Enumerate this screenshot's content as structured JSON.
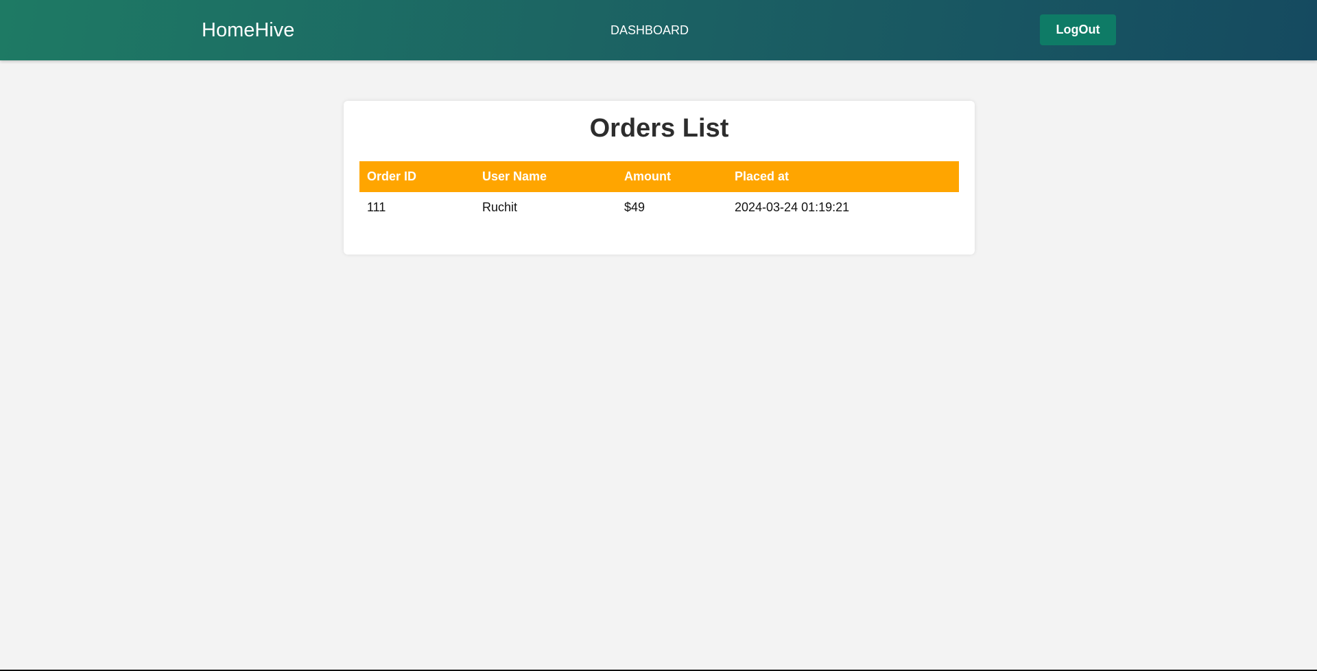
{
  "navbar": {
    "brand": "HomeHive",
    "links": [
      {
        "label": "DASHBOARD"
      }
    ],
    "logout_label": "LogOut"
  },
  "orders": {
    "title": "Orders List",
    "columns": [
      "Order ID",
      "User Name",
      "Amount",
      "Placed at"
    ],
    "rows": [
      {
        "order_id": "111",
        "user_name": "Ruchit",
        "amount": "$49",
        "placed_at": "2024-03-24 01:19:21"
      }
    ],
    "header_color": "#ffa500"
  },
  "theme": {
    "navbar_gradient_start": "#1e7a64",
    "navbar_gradient_end": "#154a60",
    "button_color": "#0e7b66",
    "background": "#f3f3f3"
  }
}
